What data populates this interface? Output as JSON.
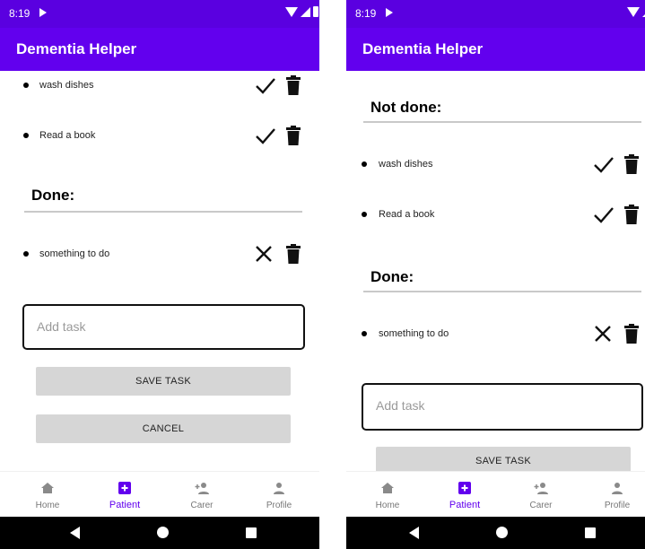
{
  "status_bar": {
    "time": "8:19"
  },
  "app_bar": {
    "title": "Dementia Helper"
  },
  "colors": {
    "status_bar": "#5a00e0",
    "app_bar": "#6200ee",
    "accent": "#6200ee",
    "button": "#d6d6d6"
  },
  "left_screen": {
    "not_done_tasks": [
      {
        "label": "wash dishes",
        "action_icon": "check-icon",
        "delete_icon": "trash-icon"
      },
      {
        "label": "Read a book",
        "action_icon": "check-icon",
        "delete_icon": "trash-icon"
      }
    ],
    "done_header": "Done:",
    "done_tasks": [
      {
        "label": "something to do",
        "action_icon": "close-icon",
        "delete_icon": "trash-icon"
      }
    ],
    "add_task_placeholder": "Add task",
    "save_button": "SAVE TASK",
    "cancel_button": "CANCEL"
  },
  "right_screen": {
    "not_done_header": "Not done:",
    "not_done_tasks": [
      {
        "label": "wash dishes",
        "action_icon": "check-icon",
        "delete_icon": "trash-icon"
      },
      {
        "label": "Read a book",
        "action_icon": "check-icon",
        "delete_icon": "trash-icon"
      }
    ],
    "done_header": "Done:",
    "done_tasks": [
      {
        "label": "something to do",
        "action_icon": "close-icon",
        "delete_icon": "trash-icon"
      }
    ],
    "add_task_placeholder": "Add task",
    "save_button": "SAVE TASK"
  },
  "bottom_nav": {
    "active": "Patient",
    "items": [
      {
        "label": "Home",
        "icon": "home-icon"
      },
      {
        "label": "Patient",
        "icon": "patient-add-icon"
      },
      {
        "label": "Carer",
        "icon": "person-add-icon"
      },
      {
        "label": "Profile",
        "icon": "person-icon"
      }
    ]
  }
}
